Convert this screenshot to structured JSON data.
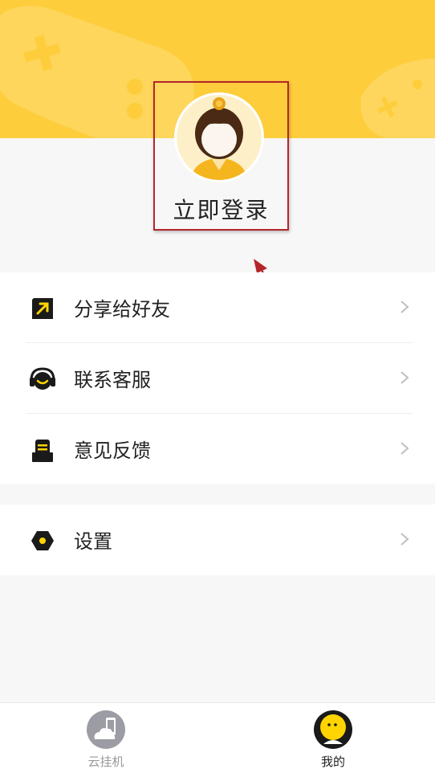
{
  "header": {
    "login_label": "立即登录"
  },
  "menu_group1": [
    {
      "label": "分享给好友",
      "icon": "share-icon"
    },
    {
      "label": "联系客服",
      "icon": "headset-icon"
    },
    {
      "label": "意见反馈",
      "icon": "feedback-icon"
    }
  ],
  "menu_group2": [
    {
      "label": "设置",
      "icon": "settings-icon"
    }
  ],
  "tabbar": {
    "tab_cloud": {
      "label": "云挂机",
      "icon": "cloud-phone-icon",
      "active": false
    },
    "tab_mine": {
      "label": "我的",
      "icon": "mine-face-icon",
      "active": true
    }
  },
  "colors": {
    "header_yellow": "#fdcd3c",
    "accent_yellow": "#ffd400",
    "annotation_red": "#b4262c"
  }
}
